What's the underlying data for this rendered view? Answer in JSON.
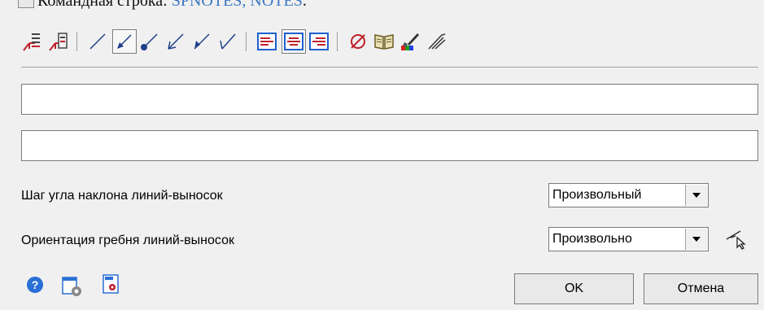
{
  "top_caption": {
    "prefix": "Командная строка: ",
    "command": "SPNOTES, NOTES",
    "suffix": "."
  },
  "toolbar": {
    "icons": [
      "leader-note-icon",
      "leader-note-frame-icon",
      "line-no-arrow-icon",
      "line-arrow-icon",
      "line-dot-icon",
      "line-open-arrow-icon",
      "line-half-arrow-icon",
      "line-tick-icon",
      "align-left-icon",
      "align-center-icon",
      "align-right-icon",
      "diameter-icon",
      "library-book-icon",
      "paint-brush-icon",
      "leader-comb-icon"
    ]
  },
  "fields": {
    "text_line_1": "",
    "text_line_2": ""
  },
  "angle_step": {
    "label": "Шаг угла наклона линий-выносок",
    "value": "Произвольный"
  },
  "comb_orientation": {
    "label": "Ориентация гребня линий-выносок",
    "value": "Произвольно"
  },
  "buttons": {
    "ok": "OK",
    "cancel": "Отмена"
  },
  "colors": {
    "accent_blue": "#1e5fcf",
    "link_blue": "#3b78c4",
    "red_icon": "#c0202a"
  }
}
